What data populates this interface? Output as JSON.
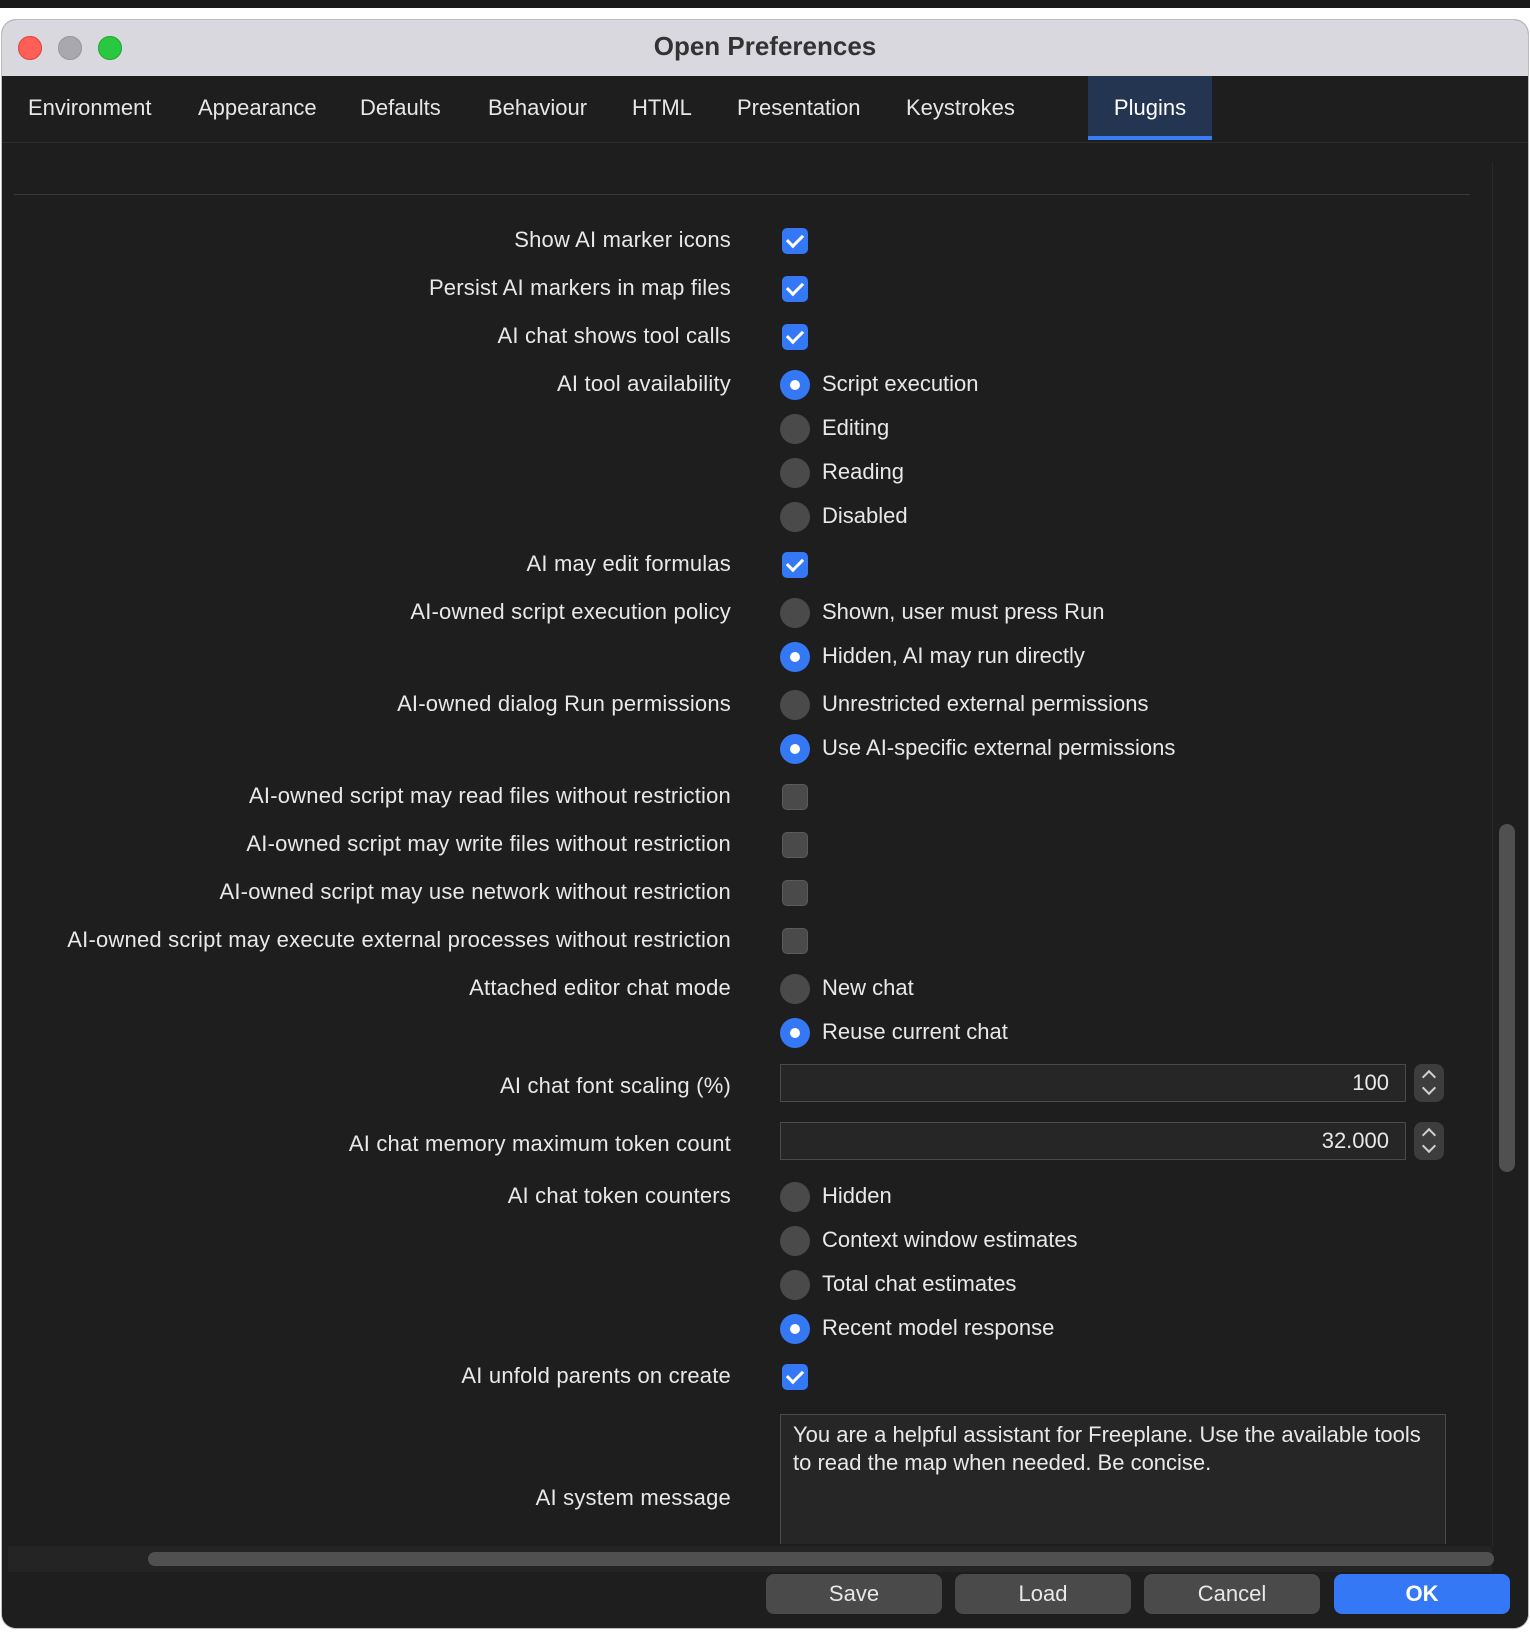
{
  "window": {
    "title": "Open Preferences"
  },
  "tabs": [
    {
      "label": "Environment"
    },
    {
      "label": "Appearance"
    },
    {
      "label": "Defaults"
    },
    {
      "label": "Behaviour"
    },
    {
      "label": "HTML"
    },
    {
      "label": "Presentation"
    },
    {
      "label": "Keystrokes"
    },
    {
      "label": "Plugins",
      "active": true
    }
  ],
  "settings": {
    "show_marker_icons": {
      "label": "Show AI marker icons",
      "checked": true
    },
    "persist_markers": {
      "label": "Persist AI markers in map files",
      "checked": true
    },
    "chat_tool_calls": {
      "label": "AI chat shows tool calls",
      "checked": true
    },
    "tool_availability": {
      "label": "AI tool availability",
      "options": [
        "Script execution",
        "Editing",
        "Reading",
        "Disabled"
      ],
      "selected": "Script execution"
    },
    "edit_formulas": {
      "label": "AI may edit formulas",
      "checked": true
    },
    "script_policy": {
      "label": "AI-owned script execution policy",
      "options": [
        "Shown, user must press Run",
        "Hidden, AI may run directly"
      ],
      "selected": "Hidden, AI may run directly"
    },
    "dialog_run": {
      "label": "AI-owned dialog Run permissions",
      "options": [
        "Unrestricted external permissions",
        "Use AI-specific external permissions"
      ],
      "selected": "Use AI-specific external permissions"
    },
    "read_files": {
      "label": "AI-owned script may read files without restriction",
      "checked": false
    },
    "write_files": {
      "label": "AI-owned script may write files without restriction",
      "checked": false
    },
    "use_network": {
      "label": "AI-owned script may use network without restriction",
      "checked": false
    },
    "exec_processes": {
      "label": "AI-owned script may execute external processes without restriction",
      "checked": false
    },
    "editor_chat_mode": {
      "label": "Attached editor chat mode",
      "options": [
        "New chat",
        "Reuse current chat"
      ],
      "selected": "Reuse current chat"
    },
    "font_scaling": {
      "label": "AI chat font scaling (%)",
      "value": "100"
    },
    "memory_tokens": {
      "label": "AI chat memory maximum token count",
      "value": "32.000"
    },
    "token_counters": {
      "label": "AI chat token counters",
      "options": [
        "Hidden",
        "Context window estimates",
        "Total chat estimates",
        "Recent model response"
      ],
      "selected": "Recent model response"
    },
    "unfold_parents": {
      "label": "AI unfold parents on create",
      "checked": true
    },
    "system_message": {
      "label": "AI system message",
      "value": "You are a helpful assistant for Freeplane. Use the available tools to read the map when needed. Be concise."
    }
  },
  "buttons": {
    "save": "Save",
    "load": "Load",
    "cancel": "Cancel",
    "ok": "OK"
  },
  "colors": {
    "accent": "#3478f6",
    "background": "#1e1e1e",
    "active_tab": "#243551"
  }
}
